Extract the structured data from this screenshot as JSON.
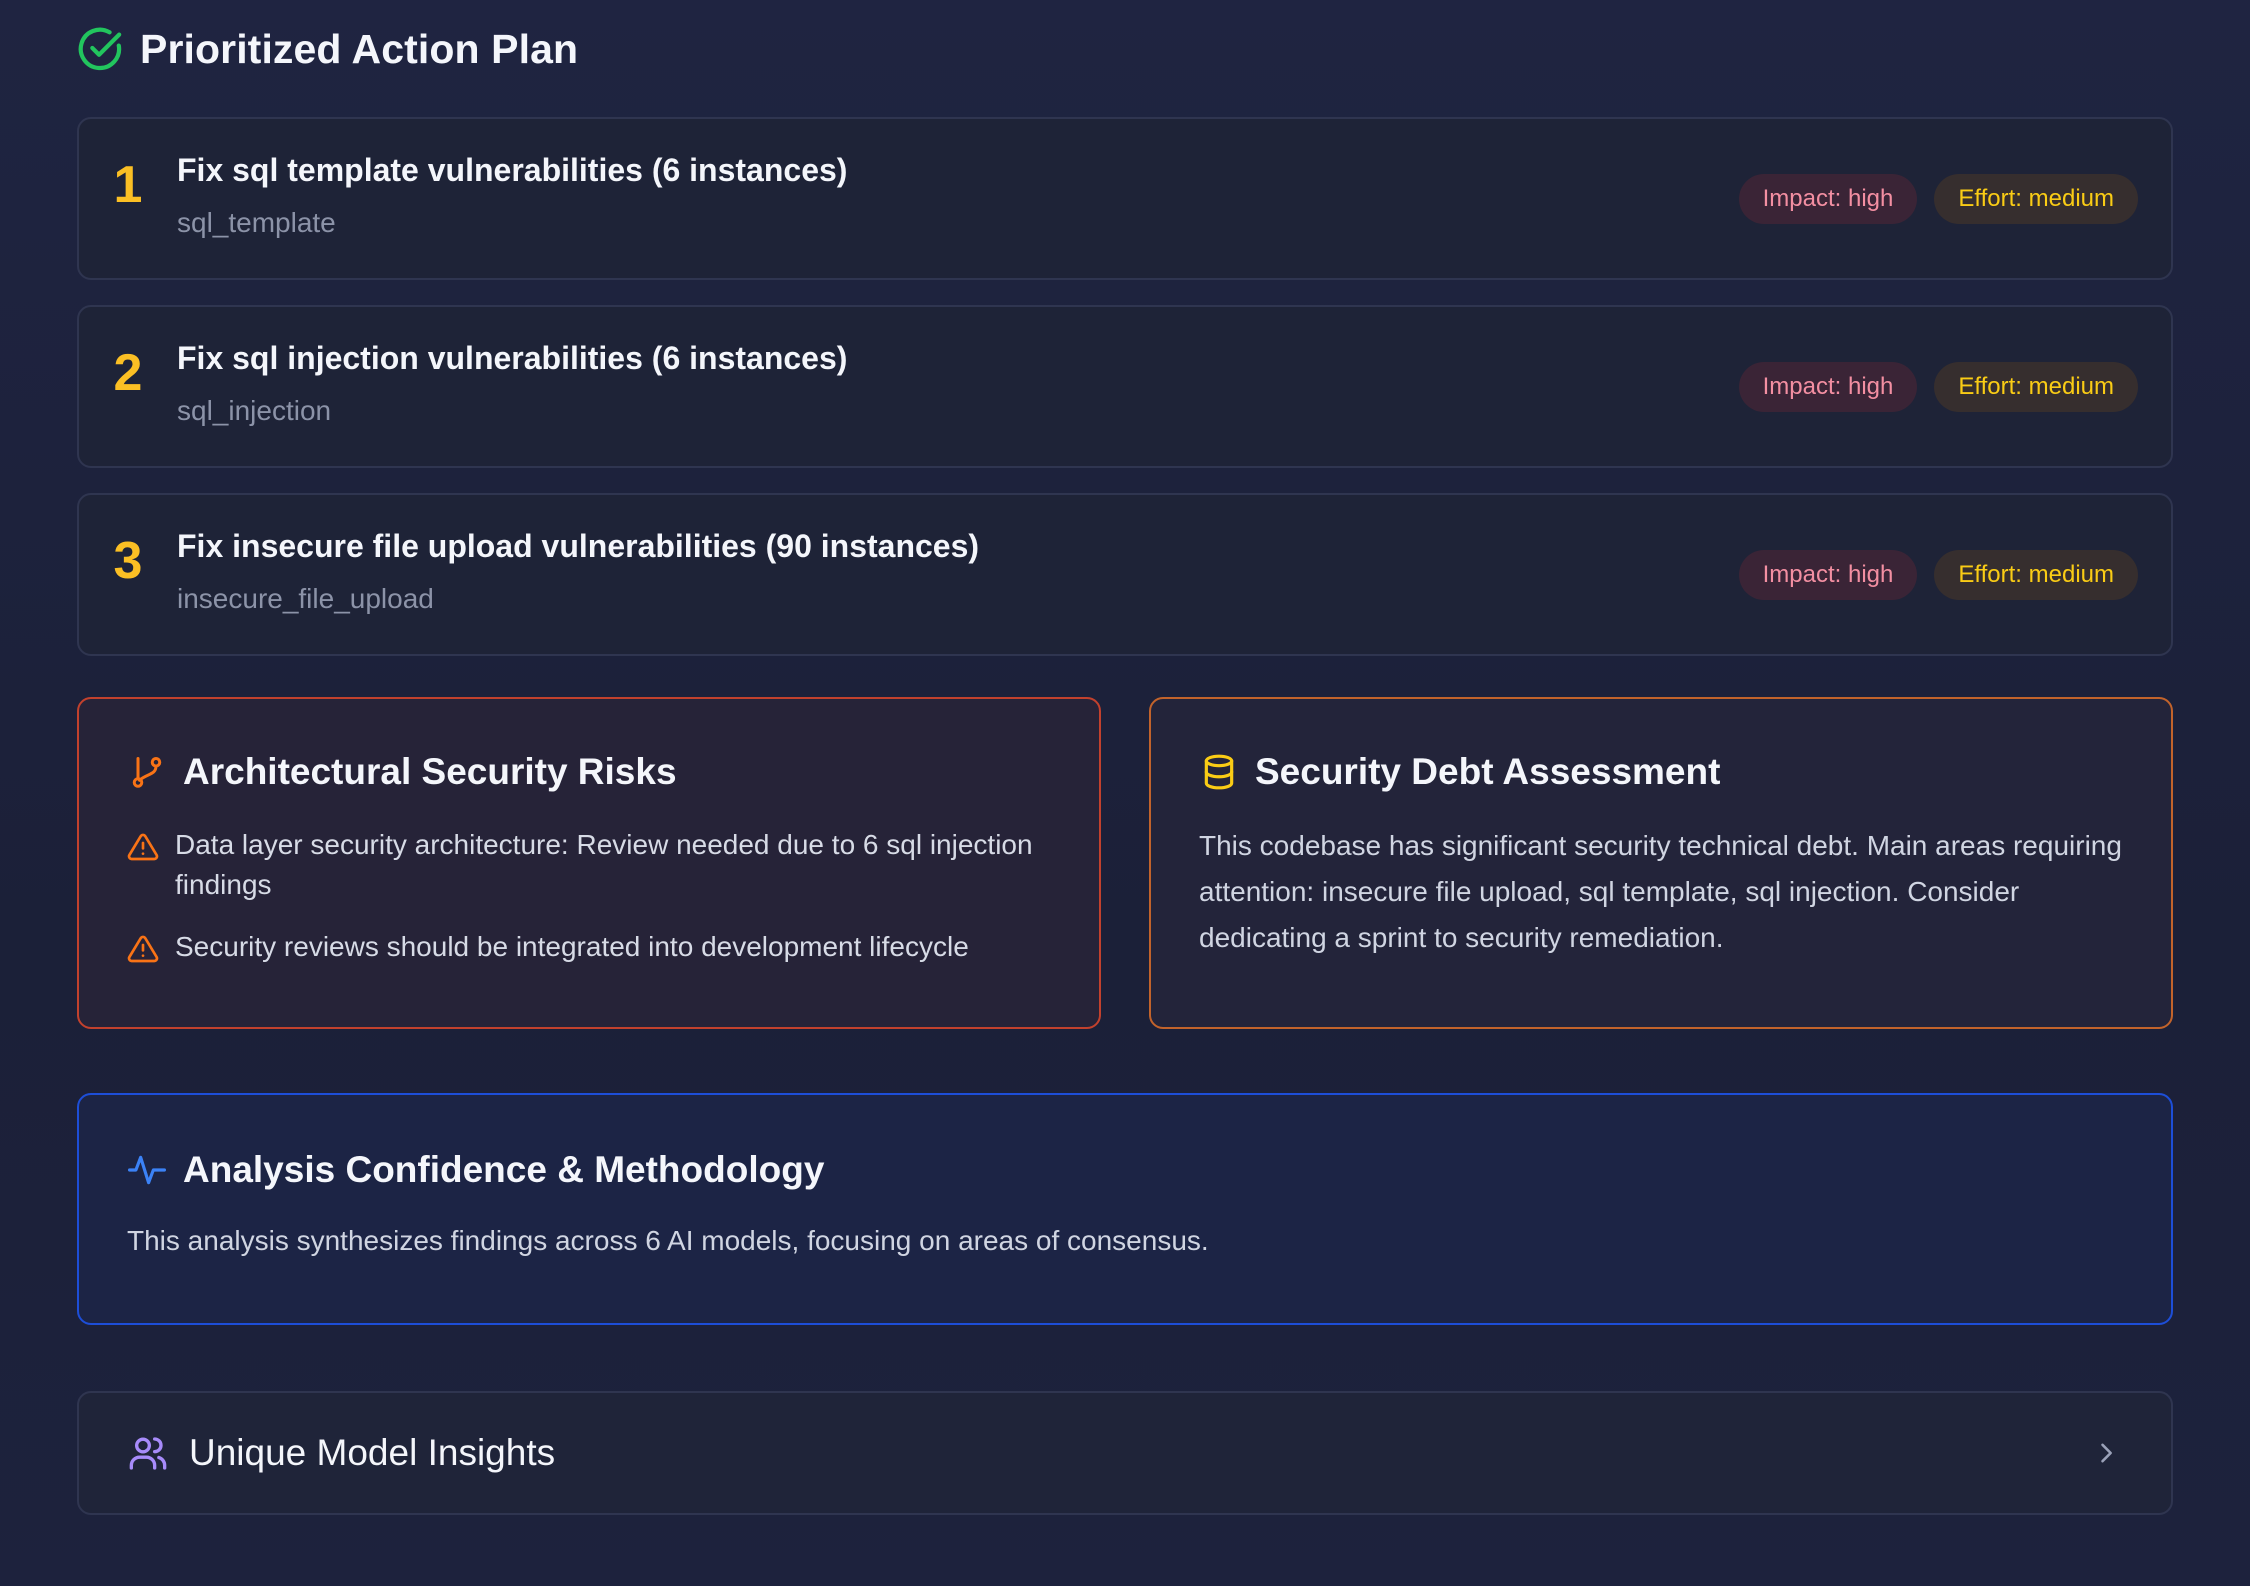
{
  "action_plan": {
    "title": "Prioritized Action Plan",
    "icon": "check-circle-icon",
    "items": [
      {
        "rank": "1",
        "title": "Fix sql template vulnerabilities (6 instances)",
        "code": "sql_template",
        "impact": "Impact: high",
        "effort": "Effort: medium"
      },
      {
        "rank": "2",
        "title": "Fix sql injection vulnerabilities (6 instances)",
        "code": "sql_injection",
        "impact": "Impact: high",
        "effort": "Effort: medium"
      },
      {
        "rank": "3",
        "title": "Fix insecure file upload vulnerabilities (90 instances)",
        "code": "insecure_file_upload",
        "impact": "Impact: high",
        "effort": "Effort: medium"
      }
    ]
  },
  "architecture": {
    "title": "Architectural Security Risks",
    "icon": "git-branch-icon",
    "risks": [
      "Data layer security architecture: Review needed due to 6 sql injection findings",
      "Security reviews should be integrated into development lifecycle"
    ]
  },
  "debt": {
    "title": "Security Debt Assessment",
    "icon": "database-icon",
    "text": "This codebase has significant security technical debt. Main areas requiring attention: insecure file upload, sql template, sql injection. Consider dedicating a sprint to security remediation."
  },
  "methodology": {
    "title": "Analysis Confidence & Methodology",
    "icon": "activity-icon",
    "text": "This analysis synthesizes findings across 6 AI models, focusing on areas of consensus."
  },
  "insights": {
    "title": "Unique Model Insights",
    "icon": "users-icon",
    "expand_icon": "chevron-right-icon"
  },
  "colors": {
    "success": "#22c55e",
    "rank": "#fbbf24",
    "impact_text": "#f38fa2",
    "effort_text": "#facc15",
    "risk_border": "#c2412d",
    "debt_border": "#c2632b",
    "method_border": "#1d4ed8",
    "purple": "#a78bfa"
  }
}
